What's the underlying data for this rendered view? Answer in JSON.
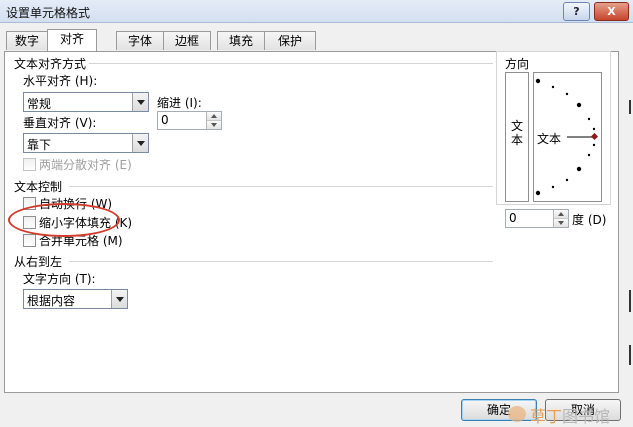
{
  "window": {
    "title": "设置单元格格式",
    "help_label": "?",
    "close_label": "X"
  },
  "tabs": [
    {
      "label": "数字",
      "active": false
    },
    {
      "label": "对齐",
      "active": true
    },
    {
      "label": "字体",
      "active": false
    },
    {
      "label": "边框",
      "active": false
    },
    {
      "label": "填充",
      "active": false
    },
    {
      "label": "保护",
      "active": false
    }
  ],
  "alignment": {
    "group_title": "文本对齐方式",
    "horizontal_label": "水平对齐 (H):",
    "horizontal_value": "常规",
    "indent_label": "缩进 (I):",
    "indent_value": "0",
    "vertical_label": "垂直对齐 (V):",
    "vertical_value": "靠下",
    "justify_distributed_label": "两端分散对齐 (E)"
  },
  "text_control": {
    "group_title": "文本控制",
    "wrap_text_label": "自动换行 (W)",
    "shrink_to_fit_label": "缩小字体填充 (K)",
    "merge_cells_label": "合并单元格 (M)"
  },
  "rtl": {
    "group_title": "从右到左",
    "direction_label": "文字方向 (T):",
    "direction_value": "根据内容"
  },
  "orientation": {
    "group_title": "方向",
    "vertical_text": "文本",
    "dial_text": "文本",
    "degrees_value": "0",
    "degrees_label": "度 (D)"
  },
  "buttons": {
    "ok_label": "确定",
    "cancel_label": "取消"
  },
  "watermark": {
    "accent": "草丁",
    "rest": "图书馆"
  },
  "colors": {
    "annotation": "#d23a2a"
  }
}
